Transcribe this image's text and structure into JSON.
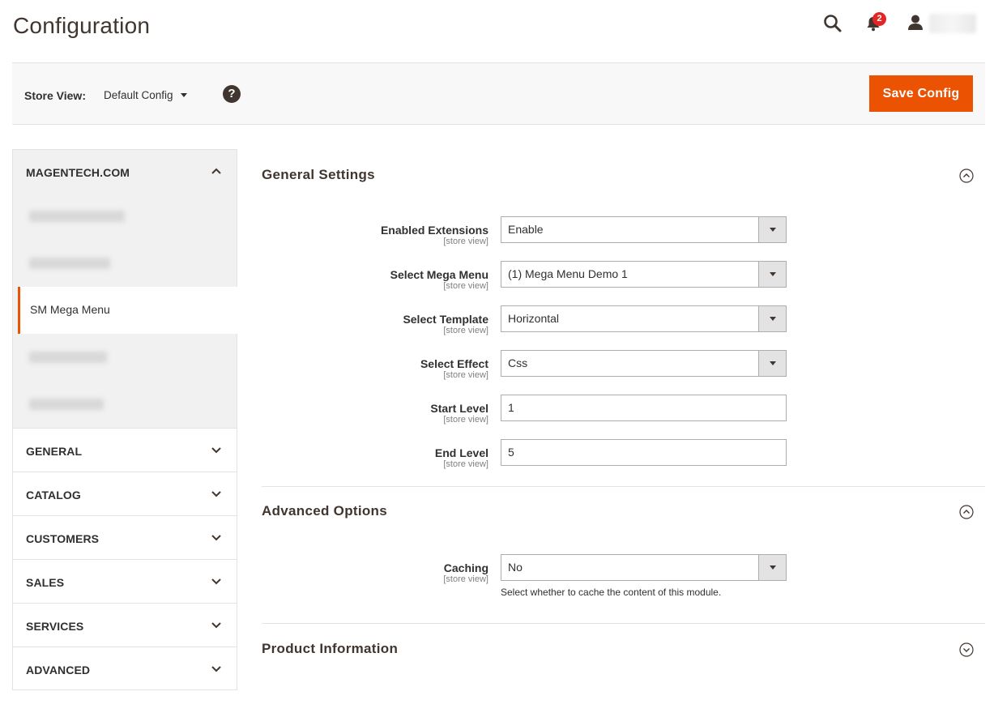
{
  "header": {
    "title": "Configuration",
    "notifications_count": "2"
  },
  "store_bar": {
    "label": "Store View:",
    "selected": "Default Config",
    "help_glyph": "?",
    "save_label": "Save Config"
  },
  "sidebar": {
    "open_section": "MAGENTECH.COM",
    "active_item": "SM Mega Menu",
    "sections": [
      "GENERAL",
      "CATALOG",
      "CUSTOMERS",
      "SALES",
      "SERVICES",
      "ADVANCED"
    ]
  },
  "general_settings": {
    "title": "General Settings",
    "scope": "[store view]",
    "fields": [
      {
        "label": "Enabled Extensions",
        "value": "Enable"
      },
      {
        "label": "Select Mega Menu",
        "value": "(1) Mega Menu Demo 1"
      },
      {
        "label": "Select Template",
        "value": "Horizontal"
      },
      {
        "label": "Select Effect",
        "value": "Css"
      },
      {
        "label": "Start Level",
        "value": "1"
      },
      {
        "label": "End Level",
        "value": "5"
      }
    ]
  },
  "advanced_options": {
    "title": "Advanced Options",
    "caching_label": "Caching",
    "caching_value": "No",
    "caching_note": "Select whether to cache the content of this module."
  },
  "product_information": {
    "title": "Product Information"
  },
  "colors": {
    "accent": "#eb5202",
    "badge": "#e22626",
    "heading": "#41362f"
  }
}
